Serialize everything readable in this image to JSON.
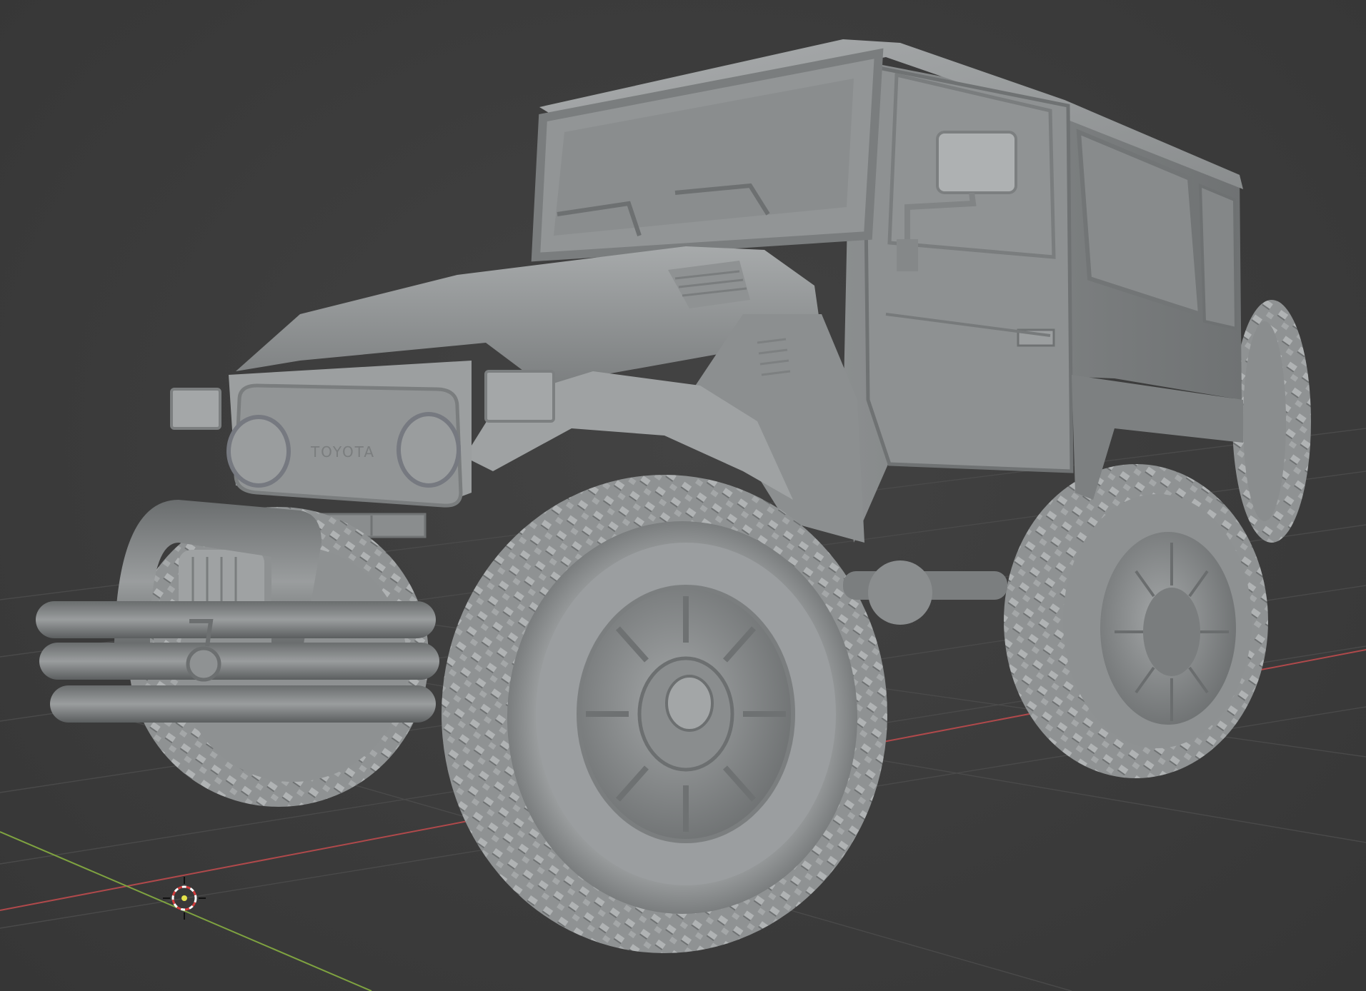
{
  "viewport": {
    "background": "#3d3d3d",
    "grid_color": "#4a4a4a",
    "x_axis_color": "#b0494b",
    "y_axis_color": "#7fa340",
    "model_color": "#9ea1a2"
  },
  "model": {
    "emblem_text": "TOYOTA"
  },
  "icons": {
    "origin": "3d-cursor-icon"
  }
}
